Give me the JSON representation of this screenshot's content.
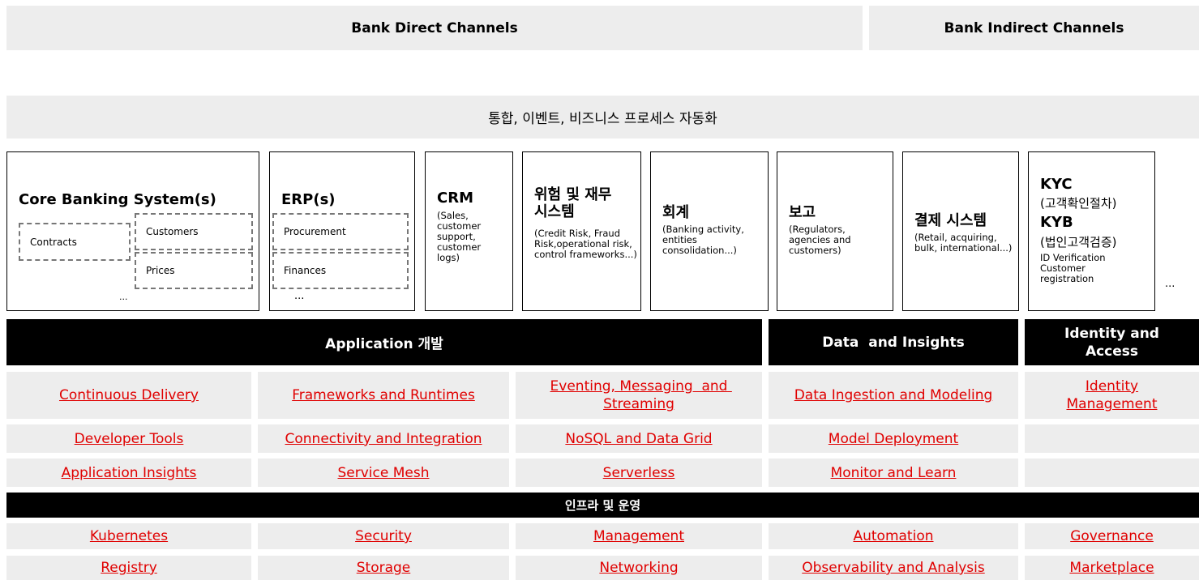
{
  "channels": {
    "direct": "Bank Direct Channels",
    "indirect": "Bank Indirect Channels"
  },
  "integration_bar": "통합, 이벤트, 비즈니스 프로세스 자동화",
  "systems": {
    "core_banking": {
      "title": "Core Banking System(s)",
      "contracts": "Contracts",
      "customers": "Customers",
      "prices": "Prices",
      "more": "..."
    },
    "erp": {
      "title": "ERP(s)",
      "procurement": "Procurement",
      "finances": "Finances",
      "more": "..."
    },
    "crm": {
      "title": "CRM",
      "desc": "(Sales, customer support, customer logs)"
    },
    "risk": {
      "title": "위험 및 재무 시스템",
      "desc": "(Credit Risk, Fraud Risk,operational risk, control frameworks...)"
    },
    "accounting": {
      "title": "회계",
      "desc": "(Banking activity, entities consolidation...)"
    },
    "reporting": {
      "title": "보고",
      "desc": "(Regulators, agencies and customers)"
    },
    "payments": {
      "title": "결제 시스템",
      "desc": "(Retail, acquiring, bulk, international...)"
    },
    "kyc": {
      "kyc_title": "KYC",
      "kyc_sub": "(고객확인절차)",
      "kyb_title": "KYB",
      "kyb_sub": "(법인고객검증)",
      "desc": "ID Verification Customer registration"
    },
    "more": "..."
  },
  "headers": {
    "app_dev": "Application 개발",
    "data": "Data  and Insights",
    "identity": "Identity and Access",
    "infra": "인프라 및 운영"
  },
  "app_rows": [
    [
      "Continuous Delivery",
      "Frameworks and Runtimes",
      "Eventing, Messaging  and Streaming",
      "Data Ingestion and Modeling",
      "Identity Management"
    ],
    [
      "Developer Tools",
      "Connectivity and Integration",
      "NoSQL and Data Grid",
      "Model Deployment",
      ""
    ],
    [
      "Application Insights",
      "Service Mesh",
      "Serverless",
      "Monitor and Learn",
      ""
    ]
  ],
  "infra_rows": [
    [
      "Kubernetes",
      "Security",
      "Management",
      "Automation",
      "Governance"
    ],
    [
      "Registry",
      "Storage",
      "Networking",
      "Observability and Analysis",
      "Marketplace"
    ]
  ],
  "colors": {
    "link": "#e00000",
    "panel": "#ededed",
    "header": "#000000"
  }
}
